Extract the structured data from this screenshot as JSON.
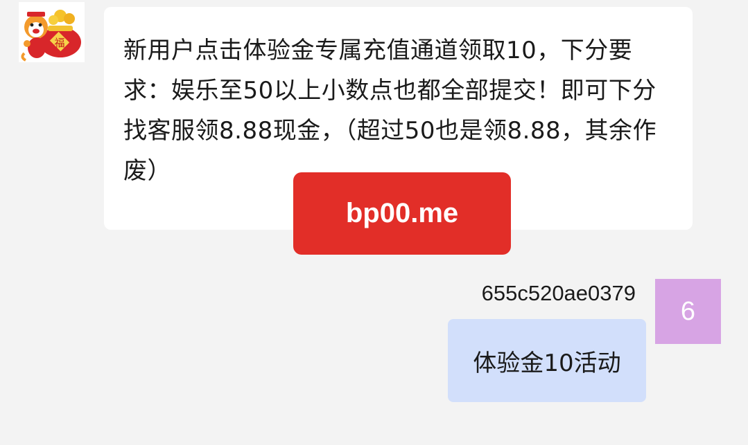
{
  "incoming_message": {
    "text": "新用户点击体验金专属充值通道领取10，下分要求：娱乐至50以上小数点也都全部提交！即可下分找客服领8.88现金，（超过50也是领8.88，其余作废）",
    "link_label": "bp00.me",
    "sender_avatar_icon": "tiger-lucky-bag-icon",
    "avatar_badge_text": "福"
  },
  "outgoing_message": {
    "sender_name": "655c520ae0379",
    "avatar_letter": "6",
    "avatar_color": "#d7a4e4",
    "text": "体验金10活动"
  },
  "colors": {
    "background": "#f3f3f3",
    "incoming_bubble": "#ffffff",
    "outgoing_bubble": "#d2dffb",
    "link_button": "#e22e28"
  }
}
